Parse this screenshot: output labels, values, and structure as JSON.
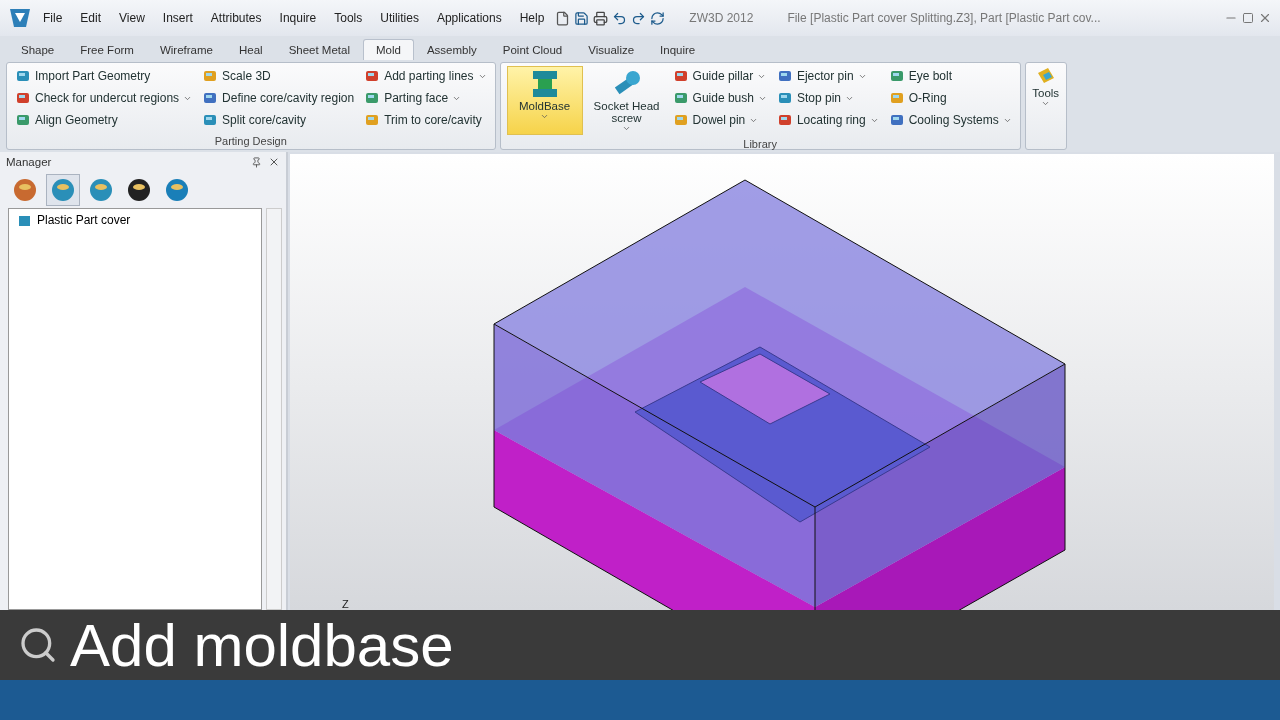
{
  "menu": [
    "File",
    "Edit",
    "View",
    "Insert",
    "Attributes",
    "Inquire",
    "Tools",
    "Utilities",
    "Applications",
    "Help"
  ],
  "app_name": "ZW3D 2012",
  "window_title": "File [Plastic Part cover Splitting.Z3],  Part [Plastic Part cov...",
  "tabs": [
    {
      "label": "Shape",
      "selected": false
    },
    {
      "label": "Free Form",
      "selected": false
    },
    {
      "label": "Wireframe",
      "selected": false
    },
    {
      "label": "Heal",
      "selected": false
    },
    {
      "label": "Sheet Metal",
      "selected": false
    },
    {
      "label": "Mold",
      "selected": true
    },
    {
      "label": "Assembly",
      "selected": false
    },
    {
      "label": "Point Cloud",
      "selected": false
    },
    {
      "label": "Visualize",
      "selected": false
    },
    {
      "label": "Inquire",
      "selected": false
    }
  ],
  "parting_design": {
    "title": "Parting Design",
    "columns": [
      [
        {
          "label": "Import Part Geometry",
          "has_menu": false
        },
        {
          "label": "Check for undercut regions",
          "has_menu": true
        },
        {
          "label": "Align Geometry",
          "has_menu": false
        }
      ],
      [
        {
          "label": "Scale 3D",
          "has_menu": false
        },
        {
          "label": "Define core/cavity region",
          "has_menu": false
        },
        {
          "label": "Split core/cavity",
          "has_menu": false
        }
      ],
      [
        {
          "label": "Add parting lines",
          "has_menu": true
        },
        {
          "label": "Parting face",
          "has_menu": true
        },
        {
          "label": "Trim to core/cavity",
          "has_menu": false
        }
      ]
    ]
  },
  "library": {
    "title": "Library",
    "large": [
      {
        "label": "MoldBase",
        "selected": true
      },
      {
        "label": "Socket Head screw",
        "selected": false
      }
    ],
    "columns": [
      [
        {
          "label": "Guide pillar",
          "has_menu": true
        },
        {
          "label": "Guide bush",
          "has_menu": true
        },
        {
          "label": "Dowel pin",
          "has_menu": true
        }
      ],
      [
        {
          "label": "Ejector pin",
          "has_menu": true
        },
        {
          "label": "Stop pin",
          "has_menu": true
        },
        {
          "label": "Locating ring",
          "has_menu": true
        }
      ],
      [
        {
          "label": "Eye bolt",
          "has_menu": false
        },
        {
          "label": "O-Ring",
          "has_menu": false
        },
        {
          "label": "Cooling Systems",
          "has_menu": true
        }
      ]
    ]
  },
  "tools_button": "Tools",
  "manager": {
    "title": "Manager",
    "tabs": [
      {
        "selected": false
      },
      {
        "selected": true
      },
      {
        "selected": false
      },
      {
        "selected": false
      },
      {
        "selected": false
      }
    ],
    "tree": [
      {
        "label": "Plastic Part cover"
      }
    ]
  },
  "axis_label": "Z",
  "caption": "Add moldbase"
}
